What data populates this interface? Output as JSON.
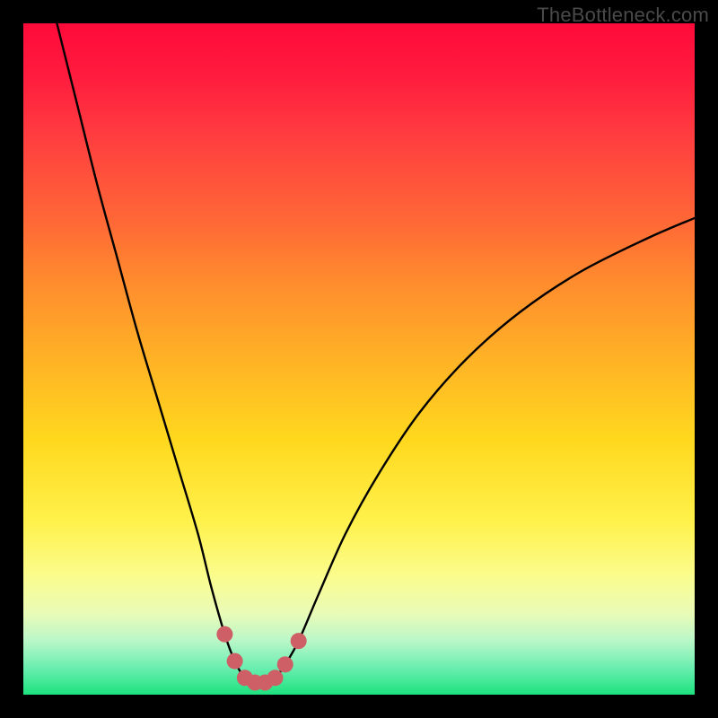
{
  "watermark": "TheBottleneck.com",
  "chart_data": {
    "type": "line",
    "title": "",
    "xlabel": "",
    "ylabel": "",
    "xlim": [
      0,
      100
    ],
    "ylim": [
      0,
      100
    ],
    "series": [
      {
        "name": "bottleneck-curve",
        "color": "#000000",
        "x": [
          5,
          8,
          11,
          14,
          17,
          20,
          23,
          26,
          28,
          30,
          31.5,
          33,
          34.5,
          36,
          37.5,
          39,
          41,
          44,
          48,
          53,
          59,
          66,
          74,
          83,
          93,
          100
        ],
        "y": [
          100,
          88,
          76,
          65,
          54,
          44,
          34,
          24,
          16,
          9,
          5,
          2.5,
          1.8,
          1.8,
          2.5,
          4.5,
          8,
          15,
          24,
          33,
          42,
          50,
          57,
          63,
          68,
          71
        ]
      }
    ],
    "markers": {
      "name": "highlight-dots",
      "color": "#cf5f66",
      "radius_px": 9,
      "x": [
        30,
        31.5,
        33,
        34.5,
        36,
        37.5,
        39,
        41
      ],
      "y": [
        9,
        5,
        2.5,
        1.8,
        1.8,
        2.5,
        4.5,
        8
      ]
    }
  }
}
